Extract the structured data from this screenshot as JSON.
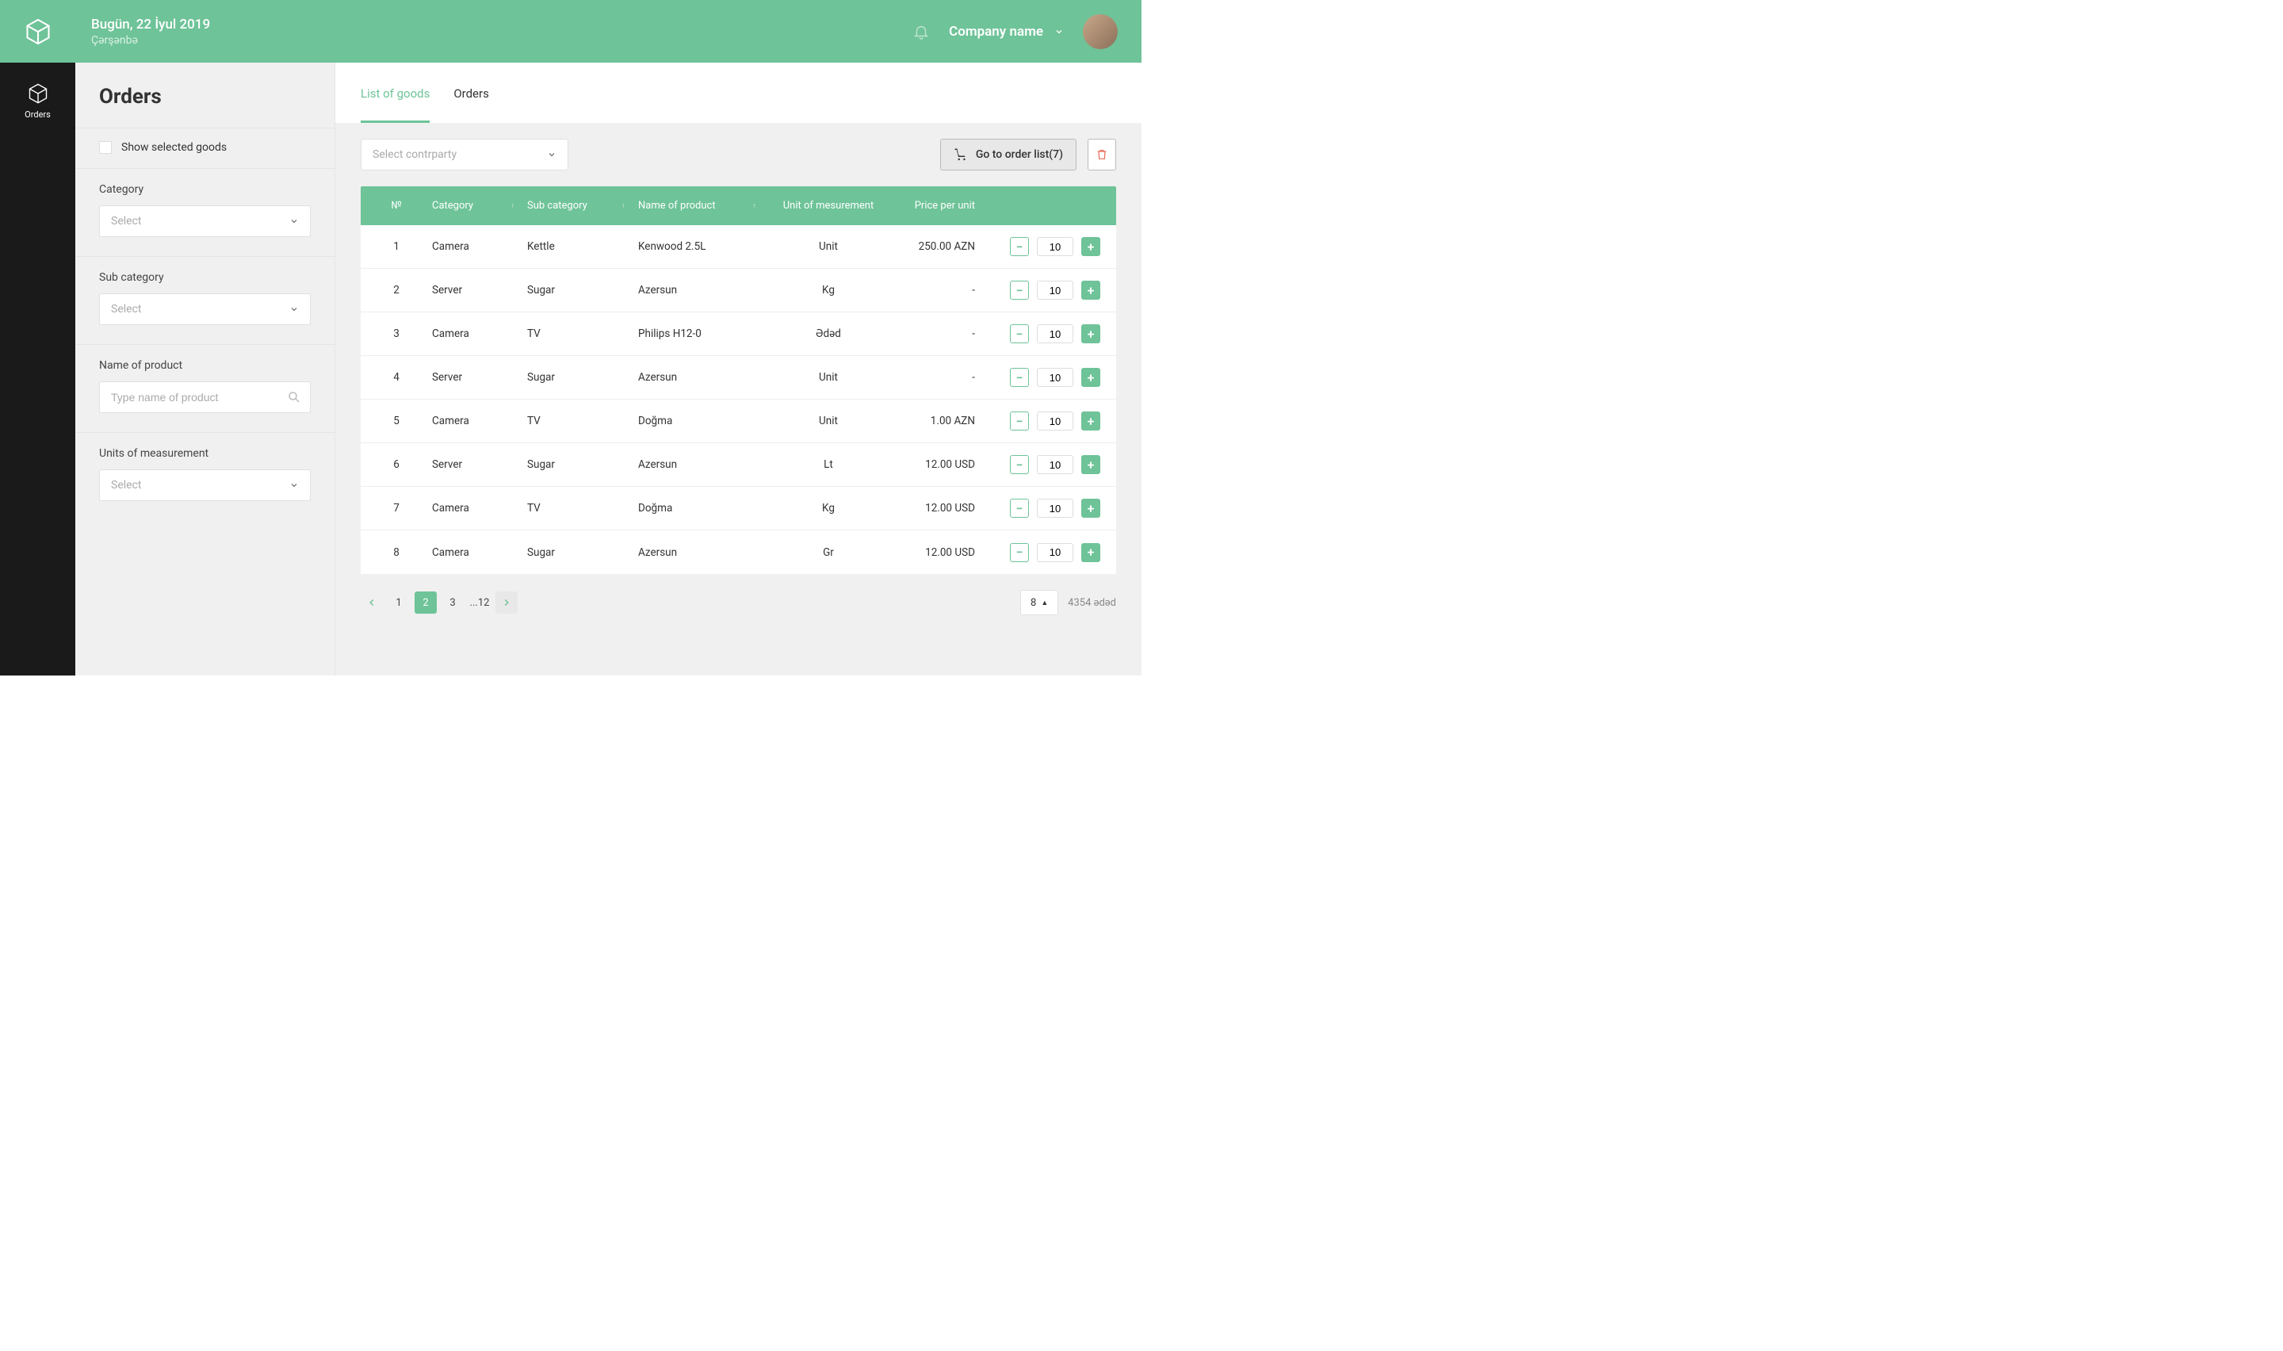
{
  "header": {
    "date": "Bugün, 22 İyul 2019",
    "day": "Çərşənbə",
    "company": "Company name"
  },
  "nav": {
    "orders": "Orders"
  },
  "sidebar": {
    "title": "Orders",
    "show_selected": "Show selected goods",
    "category_label": "Category",
    "category_placeholder": "Select",
    "subcategory_label": "Sub category",
    "subcategory_placeholder": "Select",
    "product_label": "Name of product",
    "product_placeholder": "Type name of product",
    "units_label": "Units of measurement",
    "units_placeholder": "Select"
  },
  "tabs": {
    "list": "List of goods",
    "orders": "Orders"
  },
  "toolbar": {
    "counterparty_placeholder": "Select contrparty",
    "go_order": "Go to order list(7)"
  },
  "table": {
    "headers": {
      "num": "№",
      "category": "Category",
      "subcategory": "Sub category",
      "name": "Name of product",
      "unit": "Unit of mesurement",
      "price": "Price per unit"
    },
    "rows": [
      {
        "num": "1",
        "category": "Camera",
        "sub": "Kettle",
        "name": "Kenwood 2.5L",
        "unit": "Unit",
        "price": "250.00 AZN",
        "qty": "10"
      },
      {
        "num": "2",
        "category": "Server",
        "sub": "Sugar",
        "name": "Azersun",
        "unit": "Kg",
        "price": "-",
        "qty": "10"
      },
      {
        "num": "3",
        "category": "Camera",
        "sub": "TV",
        "name": "Philips H12-0",
        "unit": "Ədəd",
        "price": "-",
        "qty": "10"
      },
      {
        "num": "4",
        "category": "Server",
        "sub": "Sugar",
        "name": "Azersun",
        "unit": "Unit",
        "price": "-",
        "qty": "10"
      },
      {
        "num": "5",
        "category": "Camera",
        "sub": "TV",
        "name": "Doğma",
        "unit": "Unit",
        "price": "1.00 AZN",
        "qty": "10"
      },
      {
        "num": "6",
        "category": "Server",
        "sub": "Sugar",
        "name": "Azersun",
        "unit": "Lt",
        "price": "12.00 USD",
        "qty": "10"
      },
      {
        "num": "7",
        "category": "Camera",
        "sub": "TV",
        "name": "Doğma",
        "unit": "Kg",
        "price": "12.00 USD",
        "qty": "10"
      },
      {
        "num": "8",
        "category": "Camera",
        "sub": "Sugar",
        "name": "Azersun",
        "unit": "Gr",
        "price": "12.00 USD",
        "qty": "10"
      }
    ]
  },
  "pagination": {
    "pages": [
      "1",
      "2",
      "3",
      "...12"
    ],
    "active": "2",
    "page_size": "8",
    "total": "4354 ədəd"
  }
}
